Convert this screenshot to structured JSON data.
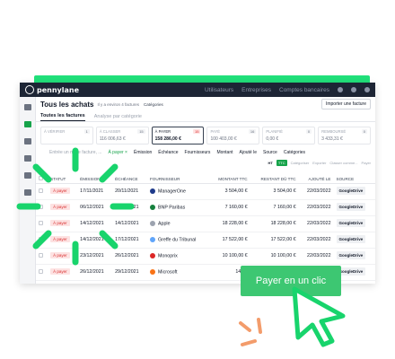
{
  "app": {
    "logo": "pennylane",
    "nav": [
      "Utilisateurs",
      "Entreprises",
      "Comptes bancaires"
    ]
  },
  "header": {
    "title": "Tous les achats",
    "note": "Il y a environ 4 factures",
    "link": "Catégories",
    "import_button": "Importer une facture"
  },
  "tabs": [
    "Toutes les factures",
    "Analyse par catégorie"
  ],
  "cards": [
    {
      "label": "À VÉRIFIER",
      "count": "1",
      "amount": ""
    },
    {
      "label": "À CLASSER",
      "count": "15",
      "amount": "116 006,63 €"
    },
    {
      "label": "À PAYER",
      "count": "15",
      "amount": "158 286,00 €"
    },
    {
      "label": "PAYÉ",
      "count": "16",
      "amount": "100 403,00 €"
    },
    {
      "label": "PLANIFIÉ",
      "count": "0",
      "amount": "0,00 €"
    },
    {
      "label": "REMBOURSÉ",
      "count": "0",
      "amount": "3 433,31 €"
    }
  ],
  "filters": {
    "search": "Entrée un n° de facture, ...",
    "chip": "À payer ×",
    "items": [
      "Émission",
      "Échéance",
      "Fournisseurs",
      "Montant",
      "Ajouté le",
      "Source",
      "Catégories"
    ]
  },
  "actions": {
    "ht": "HT",
    "ttc": "TTC",
    "items": [
      "Catégoriser",
      "Exporter",
      "Classer comme...",
      "Payer"
    ]
  },
  "table": {
    "headers": [
      "STATUT",
      "ÉMISSION",
      "ÉCHÉANCE",
      "FOURNISSEUR",
      "MONTANT TTC",
      "RESTANT DÛ TTC",
      "AJOUTÉ LE",
      "SOURCE"
    ],
    "rows": [
      {
        "status": "À payer",
        "emission": "17/11/2021",
        "echeance": "20/11/2021",
        "supplier": "ManagerOne",
        "montant": "3 504,00 €",
        "restant": "3 504,00 €",
        "ajoute": "22/03/2022",
        "source": "GoogleDrive",
        "icon_color": "#1e3a8a"
      },
      {
        "status": "À payer",
        "emission": "06/12/2021",
        "echeance": "08/12/2021",
        "supplier": "BNP Paribas",
        "montant": "7 160,00 €",
        "restant": "7 160,00 €",
        "ajoute": "22/03/2022",
        "source": "GoogleDrive",
        "icon_color": "#15803d"
      },
      {
        "status": "À payer",
        "emission": "14/12/2021",
        "echeance": "14/12/2021",
        "supplier": "Apple",
        "montant": "18 228,00 €",
        "restant": "18 228,00 €",
        "ajoute": "22/03/2022",
        "source": "GoogleDrive",
        "icon_color": "#9ca3af"
      },
      {
        "status": "À payer",
        "emission": "14/12/2021",
        "echeance": "17/12/2021",
        "supplier": "Greffe du Tribunal",
        "montant": "17 522,00 €",
        "restant": "17 522,00 €",
        "ajoute": "22/03/2022",
        "source": "GoogleDrive",
        "icon_color": "#60a5fa"
      },
      {
        "status": "À payer",
        "emission": "23/12/2021",
        "echeance": "26/12/2021",
        "supplier": "Monoprix",
        "montant": "10 100,00 €",
        "restant": "10 100,00 €",
        "ajoute": "22/03/2022",
        "source": "GoogleDrive",
        "icon_color": "#dc2626"
      },
      {
        "status": "À payer",
        "emission": "26/12/2021",
        "echeance": "29/12/2021",
        "supplier": "Microsoft",
        "montant": "14 88",
        "restant": "",
        "ajoute": "",
        "source": "GoogleDrive",
        "icon_color": "#f97316"
      }
    ]
  },
  "cta": {
    "label": "Payer en un clic"
  },
  "colors": {
    "brand_green": "#21e07a",
    "cta_green": "#3dc772",
    "cursor_green": "#18d46c",
    "accent_orange": "#f39c6b",
    "navy": "#1d2535"
  }
}
